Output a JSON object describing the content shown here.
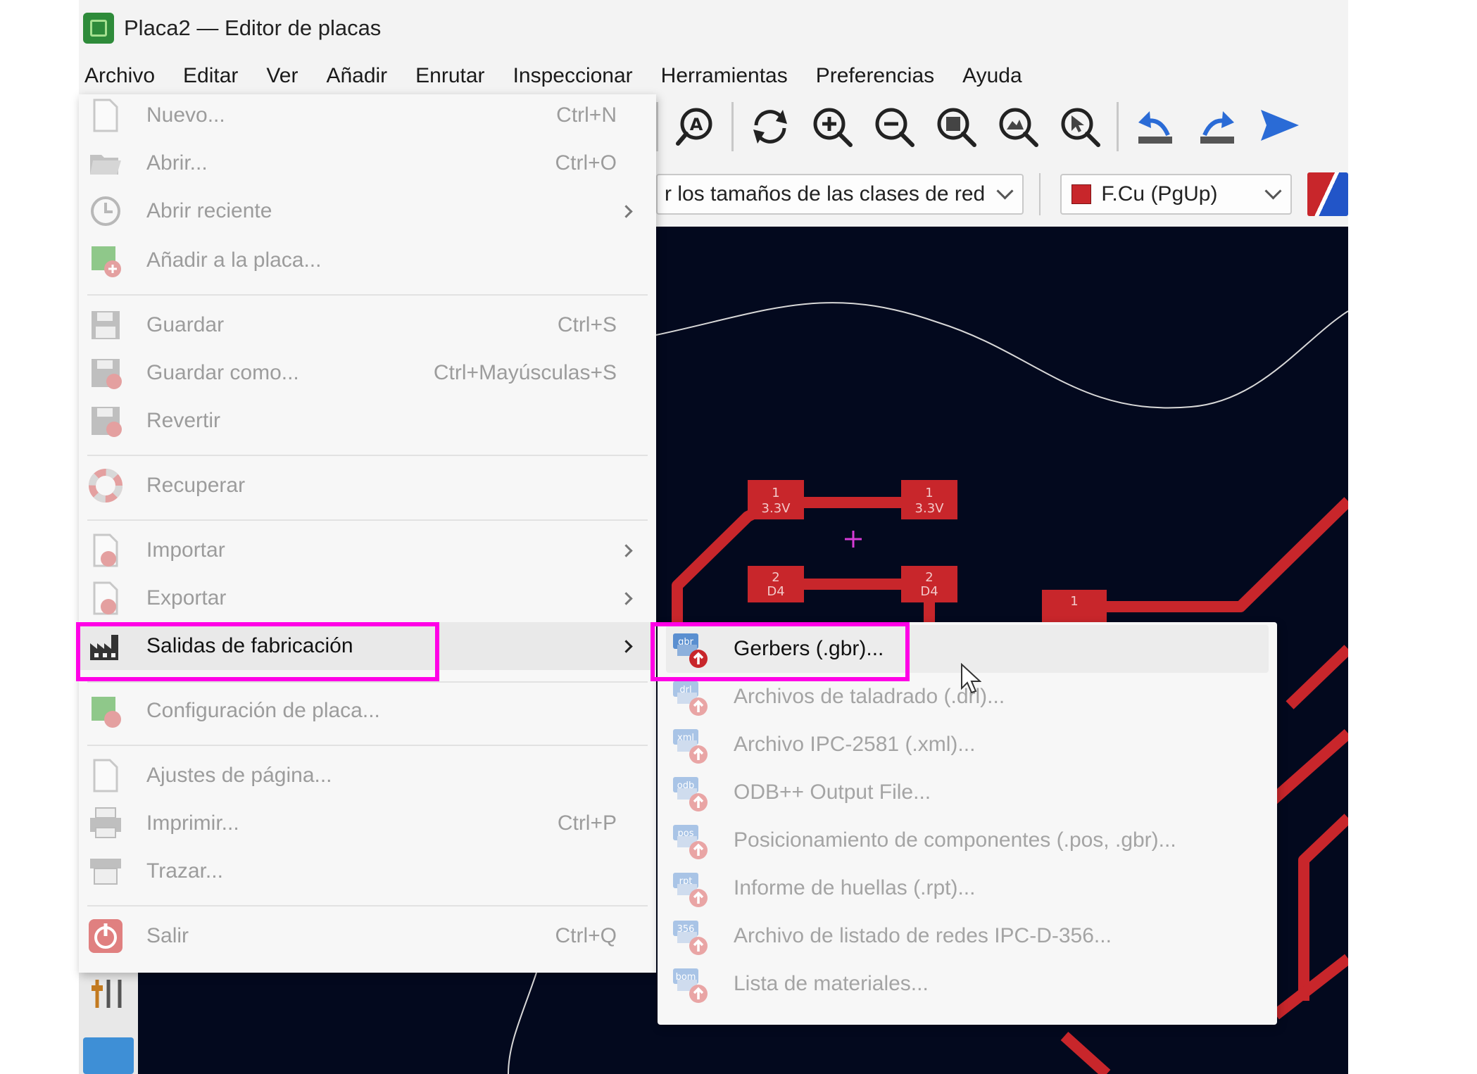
{
  "window": {
    "title": "Placa2 — Editor de placas"
  },
  "menubar": [
    "Archivo",
    "Editar",
    "Ver",
    "Añadir",
    "Enrutar",
    "Inspeccionar",
    "Herramientas",
    "Preferencias",
    "Ayuda"
  ],
  "toolbar": {
    "icons": [
      "net-inspector-icon",
      "refresh-icon",
      "zoom-in-icon",
      "zoom-out-icon",
      "zoom-fit-icon",
      "zoom-objects-icon",
      "zoom-selection-icon",
      "undo-icon",
      "redo-icon",
      "play-icon"
    ]
  },
  "subtoolbar": {
    "netclass_select": "r los tamaños de las clases de red",
    "layer_select": "F.Cu (PgUp)",
    "layer_color": "#c8262b"
  },
  "file_menu": {
    "items": [
      {
        "label": "Nuevo...",
        "shortcut": "Ctrl+N",
        "icon": "new-file-icon"
      },
      {
        "label": "Abrir...",
        "shortcut": "Ctrl+O",
        "icon": "open-folder-icon"
      },
      {
        "label": "Abrir reciente",
        "shortcut": "",
        "icon": "clock-icon",
        "submenu": true
      },
      {
        "label": "Añadir a la placa...",
        "shortcut": "",
        "icon": "add-board-icon"
      },
      {
        "label": "Guardar",
        "shortcut": "Ctrl+S",
        "icon": "save-icon"
      },
      {
        "label": "Guardar como...",
        "shortcut": "Ctrl+Mayúsculas+S",
        "icon": "save-as-icon"
      },
      {
        "label": "Revertir",
        "shortcut": "",
        "icon": "revert-icon"
      },
      {
        "label": "Recuperar",
        "shortcut": "",
        "icon": "rescue-icon"
      },
      {
        "label": "Importar",
        "shortcut": "",
        "icon": "import-icon",
        "submenu": true
      },
      {
        "label": "Exportar",
        "shortcut": "",
        "icon": "export-icon",
        "submenu": true
      },
      {
        "label": "Salidas de fabricación",
        "shortcut": "",
        "icon": "factory-icon",
        "submenu": true,
        "active": true
      },
      {
        "label": "Configuración de placa...",
        "shortcut": "",
        "icon": "board-setup-icon"
      },
      {
        "label": "Ajustes de página...",
        "shortcut": "",
        "icon": "page-setup-icon"
      },
      {
        "label": "Imprimir...",
        "shortcut": "Ctrl+P",
        "icon": "printer-icon"
      },
      {
        "label": "Trazar...",
        "shortcut": "",
        "icon": "plotter-icon"
      },
      {
        "label": "Salir",
        "shortcut": "Ctrl+Q",
        "icon": "power-icon"
      }
    ]
  },
  "fab_submenu": {
    "items": [
      {
        "label": "Gerbers (.gbr)...",
        "tag": "gbr",
        "active": true
      },
      {
        "label": "Archivos de taladrado (.drl)...",
        "tag": "drl"
      },
      {
        "label": "Archivo IPC-2581 (.xml)...",
        "tag": "xml"
      },
      {
        "label": "ODB++ Output File...",
        "tag": "odb"
      },
      {
        "label": "Posicionamiento de componentes (.pos, .gbr)...",
        "tag": "pos"
      },
      {
        "label": "Informe de huellas (.rpt)...",
        "tag": "rpt"
      },
      {
        "label": "Archivo de listado de redes IPC-D-356...",
        "tag": "356"
      },
      {
        "label": "Lista de materiales...",
        "tag": "bom"
      }
    ]
  },
  "pcb": {
    "pads": [
      {
        "line1": "1",
        "line2": "3.3V"
      },
      {
        "line1": "1",
        "line2": "3.3V"
      },
      {
        "line1": "2",
        "line2": "D4"
      },
      {
        "line1": "2",
        "line2": "D4"
      },
      {
        "line1": "1",
        "line2": ""
      }
    ],
    "copper_color": "#c8262b",
    "background_color": "#03091e"
  }
}
